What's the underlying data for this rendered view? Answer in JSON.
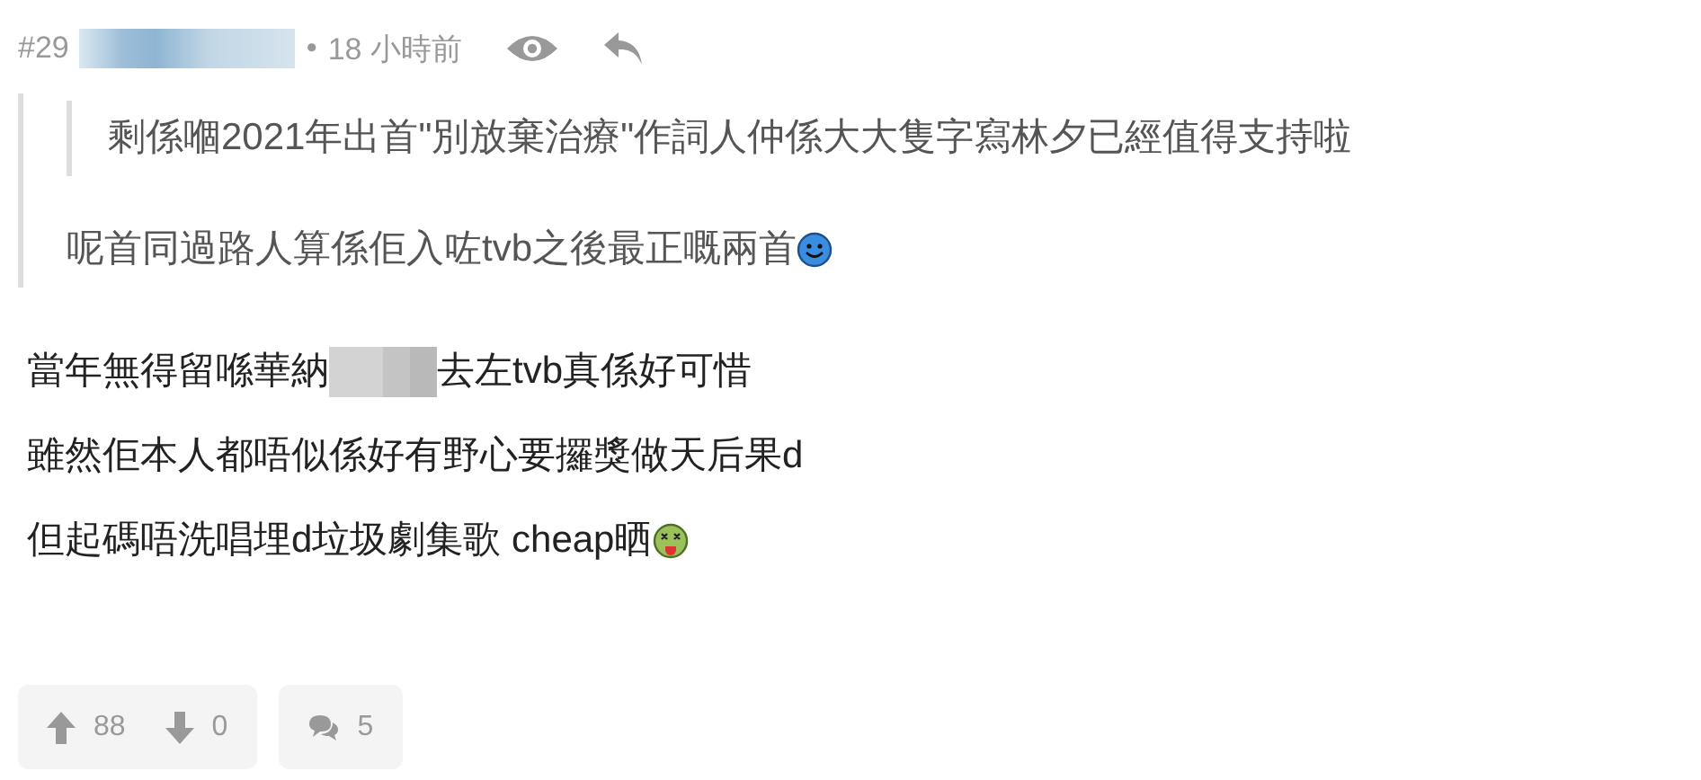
{
  "header": {
    "floor": "#29",
    "separator": "•",
    "time": "18 小時前"
  },
  "quote": {
    "nested_quote": {
      "parts": [
        {
          "kind": "text",
          "text": "剩係嗰2021年出首\"別放棄治療\"作詞人仲係大大隻字寫林夕已經值得支持啦"
        }
      ]
    },
    "parts": [
      {
        "kind": "text",
        "text": "呢首同過路人算係佢入咗tvb之後最正嘅兩首"
      },
      {
        "kind": "smiley"
      }
    ]
  },
  "body": [
    {
      "parts": [
        {
          "kind": "text",
          "text": "當年無得留喺華納"
        },
        {
          "kind": "redacted"
        },
        {
          "kind": "text",
          "text": "去左tvb真係好可惜"
        }
      ]
    },
    {
      "parts": [
        {
          "kind": "text",
          "text": "雖然佢本人都唔似係好有野心要攞獎做天后果d"
        }
      ]
    },
    {
      "parts": [
        {
          "kind": "text",
          "text": "但起碼唔洗唱埋d垃圾劇集歌 cheap晒"
        },
        {
          "kind": "sick"
        }
      ]
    }
  ],
  "actions": {
    "upvotes": "88",
    "downvotes": "0",
    "replies": "5"
  }
}
